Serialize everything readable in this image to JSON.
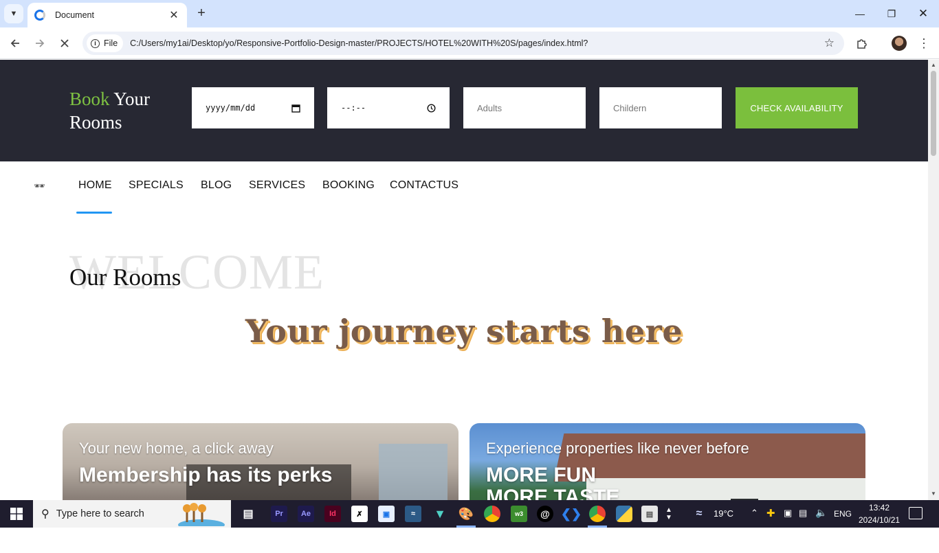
{
  "browser": {
    "tab_title": "Document",
    "site_chip": "File",
    "url": "C:/Users/my1ai/Desktop/yo/Responsive-Portfolio-Design-master/PROJECTS/HOTEL%20WITH%20S/pages/index.html?"
  },
  "booking": {
    "title_accent": "Book",
    "title_rest_line1": " Your",
    "title_line2": "Rooms",
    "date_placeholder": "yyyy/mm/dd",
    "time_placeholder": "--:--",
    "adults_placeholder": "Adults",
    "children_placeholder": "Childern",
    "check_button": "CHECK AVAILABILITY",
    "accent_color": "#7bbf3d"
  },
  "nav": {
    "items": [
      "HOME",
      "SPECIALS",
      "BLOG",
      "SERVICES",
      "BOOKING",
      "CONTACTUS"
    ],
    "active": "HOME"
  },
  "hero": {
    "welcome_bg": "WELCOME",
    "rooms_title": "Our Rooms",
    "journey": "Your journey starts here"
  },
  "cards": [
    {
      "subtitle": "Your new home, a click away",
      "heading_line1": "Membership has its perks",
      "heading_line2": ""
    },
    {
      "subtitle": "Experience properties like never before",
      "heading_line1": "MORE FUN",
      "heading_line2": "MORE TASTE"
    }
  ],
  "taskbar": {
    "search_placeholder": "Type here to search",
    "weather": "19°C",
    "lang": "ENG",
    "time": "13:42",
    "date": "2024/10/21"
  }
}
